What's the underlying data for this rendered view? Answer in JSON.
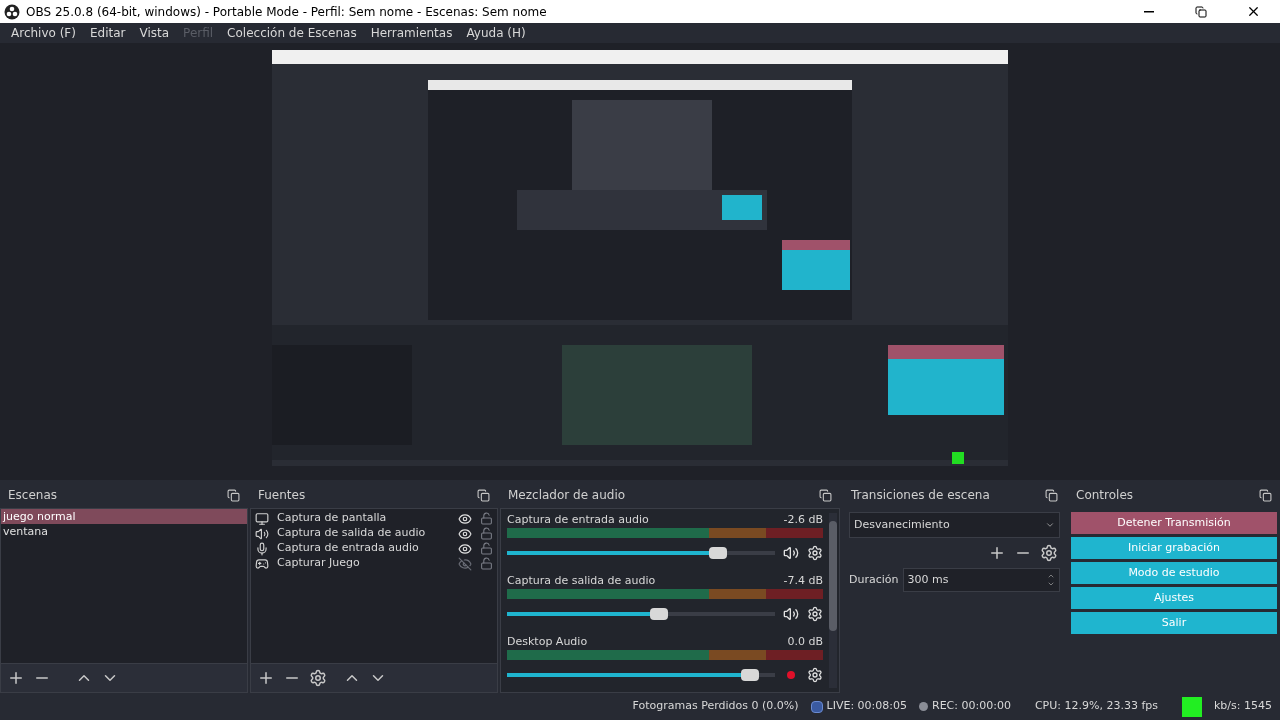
{
  "window": {
    "title": "OBS 25.0.8 (64-bit, windows) - Portable Mode - Perfil: Sem nome - Escenas: Sem nome"
  },
  "menu": [
    {
      "label": "Archivo (F)",
      "disabled": false
    },
    {
      "label": "Editar",
      "disabled": false
    },
    {
      "label": "Vista",
      "disabled": false
    },
    {
      "label": "Perfil",
      "disabled": true
    },
    {
      "label": "Colección de Escenas",
      "disabled": false
    },
    {
      "label": "Herramientas",
      "disabled": false
    },
    {
      "label": "Ayuda (H)",
      "disabled": false
    }
  ],
  "scenes": {
    "title": "Escenas",
    "items": [
      {
        "label": "juego normal",
        "selected": true
      },
      {
        "label": "ventana",
        "selected": false
      }
    ]
  },
  "sources": {
    "title": "Fuentes",
    "items": [
      {
        "kind": "monitor",
        "label": "Captura de pantalla",
        "visible": true,
        "locked": false
      },
      {
        "kind": "speaker",
        "label": "Captura de salida de audio",
        "visible": true,
        "locked": false
      },
      {
        "kind": "mic",
        "label": "Captura de entrada audio",
        "visible": true,
        "locked": false
      },
      {
        "kind": "gamepad",
        "label": "Capturar Juego",
        "visible": false,
        "locked": false
      }
    ]
  },
  "mixer": {
    "title": "Mezclador de audio",
    "channels": [
      {
        "name": "Captura de entrada audio",
        "reading": "-2.6 dB",
        "level": 0.82,
        "muted": false
      },
      {
        "name": "Captura de salida de audio",
        "reading": "-7.4 dB",
        "level": 0.6,
        "muted": false
      },
      {
        "name": "Desktop Audio",
        "reading": "0.0 dB",
        "level": 0.94,
        "muted": true
      }
    ]
  },
  "transitions": {
    "title": "Transiciones de escena",
    "transition": "Desvanecimiento",
    "duration_label": "Duración",
    "duration": "300 ms"
  },
  "controls": {
    "title": "Controles",
    "buttons": [
      {
        "label": "Detener Transmisión",
        "kind": "stop"
      },
      {
        "label": "Iniciar grabación",
        "kind": "normal"
      },
      {
        "label": "Modo de estudio",
        "kind": "normal"
      },
      {
        "label": "Ajustes",
        "kind": "normal"
      },
      {
        "label": "Salir",
        "kind": "normal"
      }
    ]
  },
  "status_bar": {
    "dropped": "Fotogramas Perdidos 0 (0.0%)",
    "live": "LIVE: 00:08:05",
    "rec": "REC: 00:00:00",
    "cpu": "CPU: 12.9%, 23.33 fps",
    "kbps": "kb/s: 1545"
  }
}
